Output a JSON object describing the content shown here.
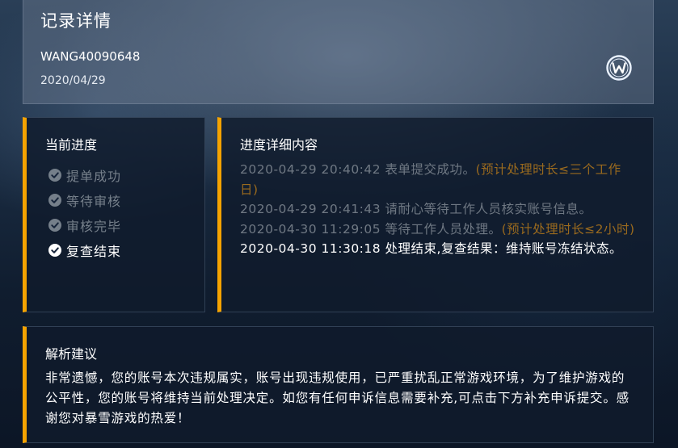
{
  "header": {
    "title": "记录详情",
    "record_id": "WANG40090648",
    "date": "2020/04/29",
    "logo_icon": "w-logo-icon"
  },
  "progress": {
    "title": "当前进度",
    "steps": [
      {
        "label": "提单成功",
        "state": "done"
      },
      {
        "label": "等待审核",
        "state": "done"
      },
      {
        "label": "审核完毕",
        "state": "done"
      },
      {
        "label": "复查结束",
        "state": "current"
      }
    ],
    "icon": "check-circle-icon"
  },
  "detail": {
    "title": "进度详细内容",
    "entries": [
      {
        "text": "2020-04-29 20:40:42 表单提交成功。",
        "note": "(预计处理时长≤三个工作日)"
      },
      {
        "text": "2020-04-29 20:41:43 请耐心等待工作人员核实账号信息。",
        "note": ""
      },
      {
        "text": "2020-04-30 11:29:05 等待工作人员处理。",
        "note": "(预计处理时长≤2小时)"
      },
      {
        "text": "2020-04-30 11:30:18 处理结束,复查结果：维持账号冻结状态。",
        "note": ""
      }
    ]
  },
  "advice": {
    "title": "解析建议",
    "text": "非常遗憾，您的账号本次违规属实，账号出现违规使用，已严重扰乱正常游戏环境，为了维护游戏的公平性，您的账号将维持当前处理决定。如您有任何申诉信息需要补充,可点击下方补充申诉提交。感谢您对暴雪游戏的热爱！"
  },
  "colors": {
    "accent": "#f5a300",
    "muted_text": "#6f7883",
    "note_text": "#9a6a1e"
  }
}
